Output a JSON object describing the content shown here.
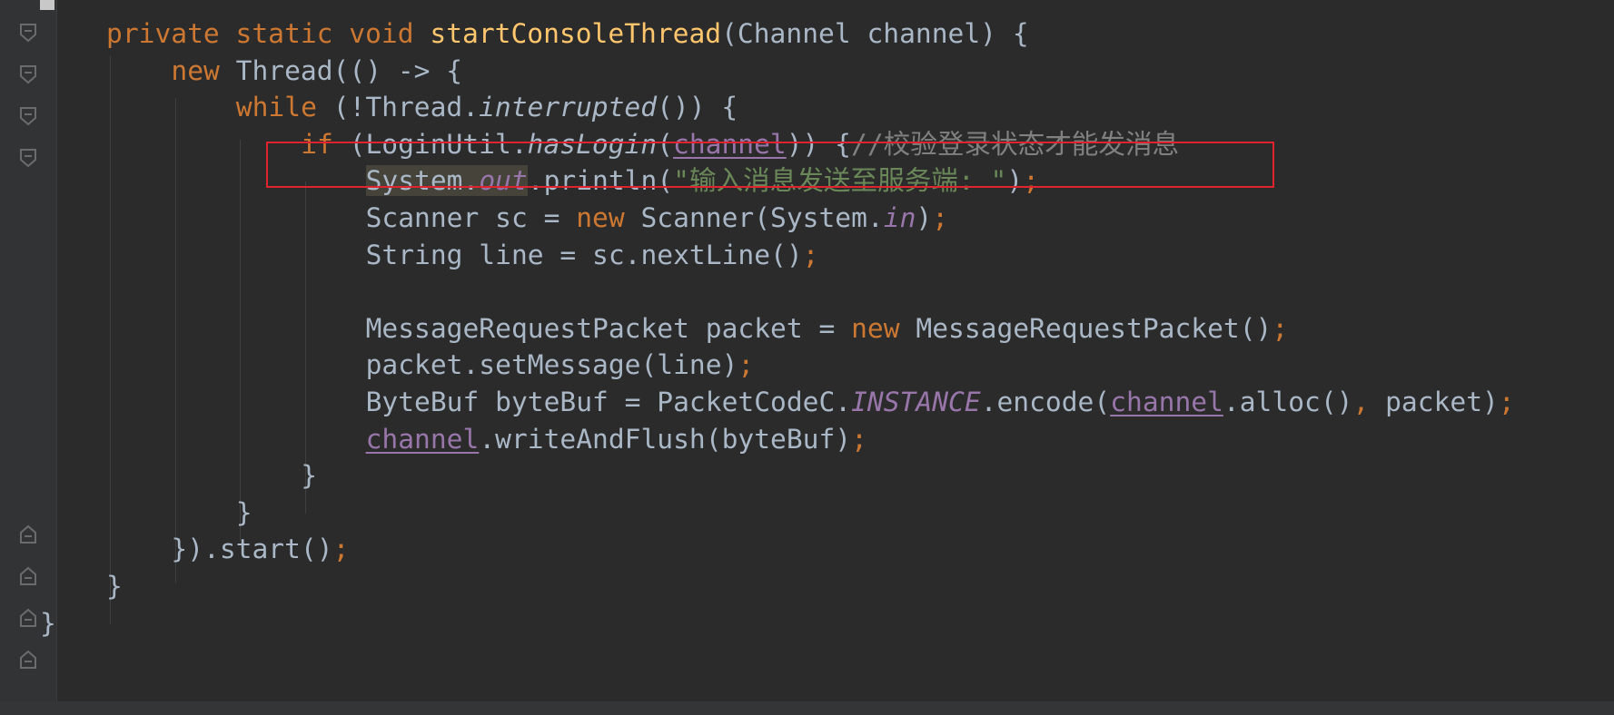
{
  "editor": {
    "language": "java",
    "theme": "darcula",
    "lines": [
      {
        "id": "method-signature",
        "text": "private static void startConsoleThread(Channel channel) {"
      },
      {
        "id": "new-thread",
        "text": "new Thread(() -> {"
      },
      {
        "id": "while-loop",
        "text": "while (!Thread.interrupted()) {"
      },
      {
        "id": "if-has-login",
        "text": "if (LoginUtil.hasLogin(channel)) {//校验登录状态才能发消息"
      },
      {
        "id": "print-prompt",
        "text": "System.out.println(\"输入消息发送至服务端: \");"
      },
      {
        "id": "scanner-decl",
        "text": "Scanner sc = new Scanner(System.in);"
      },
      {
        "id": "read-line",
        "text": "String line = sc.nextLine();"
      },
      {
        "id": "blank-line",
        "text": ""
      },
      {
        "id": "packet-decl",
        "text": "MessageRequestPacket packet = new MessageRequestPacket();"
      },
      {
        "id": "set-message",
        "text": "packet.setMessage(line);"
      },
      {
        "id": "encode-packet",
        "text": "ByteBuf byteBuf = PacketCodeC.INSTANCE.encode(channel.alloc(), packet);"
      },
      {
        "id": "write-flush",
        "text": "channel.writeAndFlush(byteBuf);"
      },
      {
        "id": "close-if",
        "text": "}"
      },
      {
        "id": "close-while",
        "text": "}"
      },
      {
        "id": "close-thread",
        "text": "}).start();"
      },
      {
        "id": "close-method",
        "text": "}"
      },
      {
        "id": "close-class",
        "text": "}"
      }
    ]
  },
  "colors": {
    "background": "#2b2b2b",
    "gutter": "#313335",
    "keyword": "#cc7832",
    "method_declaration": "#ffc66d",
    "default_text": "#a9b7c6",
    "field_static": "#9876aa",
    "string": "#6a8759",
    "comment": "#808080",
    "annotation_box": "#e0232e"
  },
  "gutter_icons": [
    "fold-open-icon",
    "fold-close-icon"
  ],
  "annotation": {
    "type": "red-rectangle",
    "target": "if-has-login"
  }
}
